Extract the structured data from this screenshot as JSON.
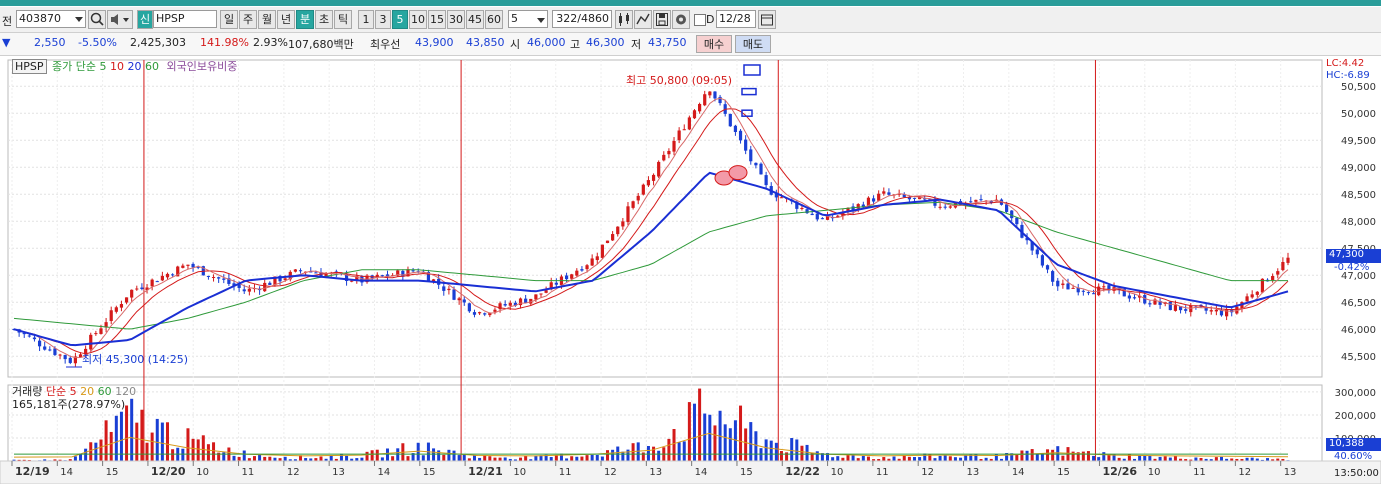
{
  "toolbar": {
    "left_fragment": "전",
    "code": "403870",
    "market_badge": "신",
    "name": "HPSP",
    "periods": [
      "일",
      "주",
      "월",
      "년",
      "분",
      "초",
      "틱"
    ],
    "active_period": "분",
    "intervals": [
      "1",
      "3",
      "5",
      "10",
      "15",
      "30",
      "45",
      "60"
    ],
    "active_interval": "5",
    "count_value": "5",
    "page_counter": "322/4860",
    "checkbox_label": "D",
    "date": "12/28"
  },
  "quote": {
    "change": "2,550",
    "change_pct": "-5.50%",
    "volume": "2,425,303",
    "volume_ratio": "141.98%",
    "turnover_pct": "2.93%",
    "amount": "107,680백만",
    "best_label": "최우선",
    "best_ask": "43,900",
    "best_bid": "43,850",
    "open_label": "시",
    "open": "46,000",
    "high_label": "고",
    "high": "46,300",
    "low_label": "저",
    "low": "43,750",
    "buy_label": "매수",
    "sell_label": "매도"
  },
  "price_panel": {
    "symbol_tag": "HPSP",
    "ma_label": "종가 단순",
    "ma_periods": [
      "5",
      "10",
      "20",
      "60"
    ],
    "foreign_label": "외국인보유비중",
    "lc_label": "LC:4.42",
    "hc_label": "HC:-6.89",
    "current_price": "47,300",
    "current_change": "-0.42%",
    "max_annotation": "최고 50,800 (09:05)",
    "min_annotation": "최저 45,300 (14:25)",
    "y_ticks": [
      "50,500",
      "50,000",
      "49,500",
      "49,000",
      "48,500",
      "48,000",
      "47,500",
      "47,000",
      "46,500",
      "46,000",
      "45,500"
    ]
  },
  "volume_panel": {
    "title": "거래량",
    "ma_label": "단순",
    "ma_periods": [
      "5",
      "20",
      "60",
      "120"
    ],
    "current_text": "165,181주(278.97%)",
    "y_ticks": [
      "300,000",
      "200,000",
      "100,000"
    ],
    "current_volume": "10,388",
    "current_pct": "40.60%"
  },
  "time_axis": {
    "labels": [
      "12/19",
      "14",
      "15",
      "12/20",
      "10",
      "11",
      "12",
      "13",
      "14",
      "15",
      "12/21",
      "10",
      "11",
      "12",
      "13",
      "14",
      "15",
      "12/22",
      "10",
      "11",
      "12",
      "13",
      "14",
      "15",
      "12/26",
      "10",
      "11",
      "12",
      "13"
    ],
    "clock": "13:50:00"
  },
  "colors": {
    "up": "#d41a1a",
    "down": "#1a3fd4",
    "ma5": "#d41a1a",
    "ma10": "#d41a1a",
    "ma20": "#1a2fd4",
    "ma60": "#2f9a3a",
    "accent": "#27a6a0"
  },
  "chart_data": {
    "type": "candlestick",
    "title": "HPSP",
    "y_range": [
      45300,
      50800
    ],
    "x": [
      "12/19 13:50",
      "12/19 14:25",
      "12/20 09:00",
      "12/20 09:30",
      "12/20 11:00",
      "12/20 13:00",
      "12/20 15:00",
      "12/21 09:00",
      "12/21 11:00",
      "12/21 13:00",
      "12/21 14:30",
      "12/21 15:10",
      "12/22 09:05",
      "12/22 10:00",
      "12/22 11:00",
      "12/22 13:00",
      "12/22 14:00",
      "12/22 15:00",
      "12/26 09:00",
      "12/26 10:00",
      "12/26 12:00",
      "12/26 13:00",
      "12/26 13:50"
    ],
    "series": [
      {
        "name": "close",
        "values": [
          46000,
          45400,
          46700,
          47200,
          46700,
          47100,
          46900,
          47100,
          46300,
          46600,
          47300,
          48800,
          50500,
          48600,
          48000,
          48500,
          48300,
          48400,
          46800,
          46700,
          46400,
          46300,
          47300
        ]
      },
      {
        "name": "ma20",
        "values": [
          46000,
          45700,
          45800,
          46400,
          46900,
          47000,
          46900,
          46900,
          46800,
          46700,
          46900,
          47800,
          48900,
          48600,
          48100,
          48300,
          48400,
          48200,
          47200,
          46800,
          46600,
          46400,
          46700
        ]
      },
      {
        "name": "ma60",
        "values": [
          46200,
          46100,
          46000,
          46200,
          46500,
          46900,
          47100,
          47100,
          47000,
          46900,
          46900,
          47200,
          47800,
          48100,
          48200,
          48300,
          48350,
          48200,
          47800,
          47500,
          47200,
          46900,
          46900
        ]
      }
    ],
    "volume": {
      "values": [
        5000,
        8000,
        250000,
        120000,
        40000,
        20000,
        30000,
        80000,
        25000,
        20000,
        40000,
        90000,
        300000,
        120000,
        40000,
        20000,
        30000,
        25000,
        60000,
        30000,
        20000,
        15000,
        10388
      ]
    }
  }
}
